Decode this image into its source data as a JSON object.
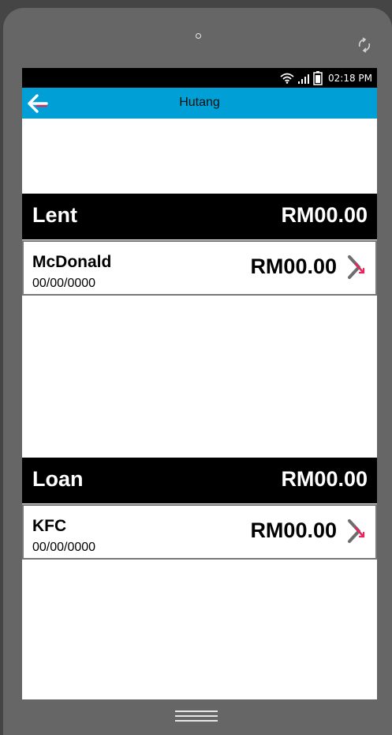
{
  "status_bar": {
    "time": "02:18 PM",
    "icons": [
      "wifi-icon",
      "signal-icon",
      "battery-icon"
    ]
  },
  "app_bar": {
    "title": "Hutang",
    "back_icon": "back-arrow-icon"
  },
  "colors": {
    "app_bar": "#00a0d6",
    "section_header": "#000000",
    "chevron": "#6d6d6d",
    "accent": "#e8245c"
  },
  "lent": {
    "title": "Lent",
    "total": "RM00.00",
    "entries": [
      {
        "name": "McDonald",
        "date": "00/00/0000",
        "amount": "RM00.00",
        "icon": "chevron-right-icon"
      }
    ]
  },
  "loan": {
    "title": "Loan",
    "total": "RM00.00",
    "entries": [
      {
        "name": "KFC",
        "date": "00/00/0000",
        "amount": "RM00.00",
        "icon": "chevron-right-icon"
      }
    ]
  },
  "device": {
    "icons": [
      "camera-icon",
      "rotate-icon",
      "home-menu-icon"
    ]
  }
}
